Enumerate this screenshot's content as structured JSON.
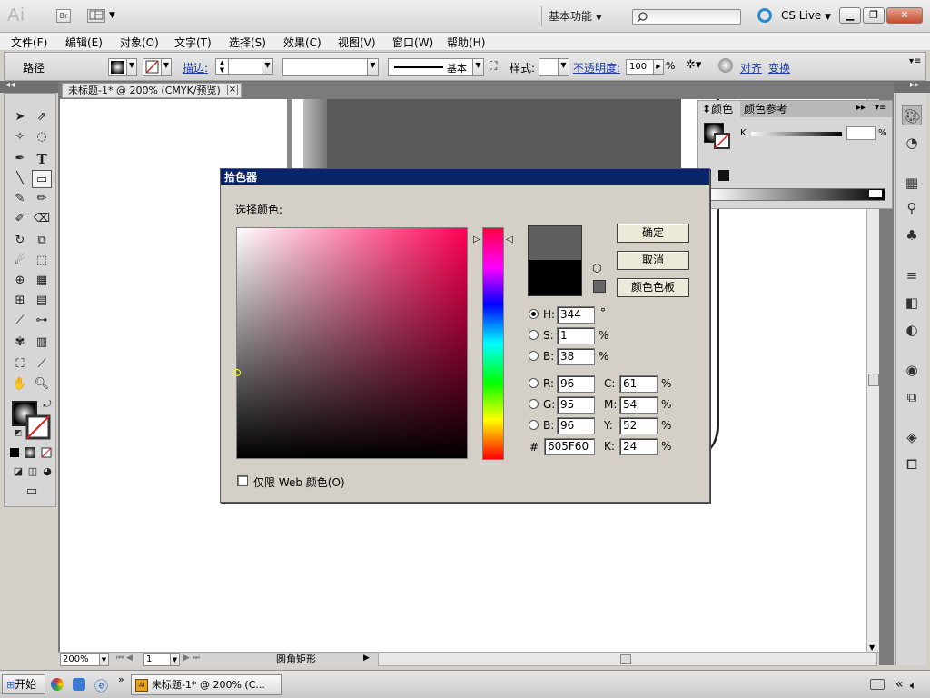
{
  "app": {
    "logo": "Ai",
    "bridge": "Br",
    "workspace": "基本功能",
    "cs_live": "CS Live"
  },
  "menu": [
    "文件(F)",
    "编辑(E)",
    "对象(O)",
    "文字(T)",
    "选择(S)",
    "效果(C)",
    "视图(V)",
    "窗口(W)",
    "帮助(H)"
  ],
  "control": {
    "object_type": "路径",
    "stroke_label": "描边:",
    "stroke_style": "基本",
    "style_label": "样式:",
    "opacity_label": "不透明度:",
    "opacity_value": "100",
    "opacity_unit": "%",
    "align": "对齐",
    "transform": "变换"
  },
  "document": {
    "tab": "未标题-1* @ 200% (CMYK/预览)",
    "close": "×",
    "zoom": "200%",
    "page": "1",
    "status_tool": "圆角矩形"
  },
  "color_panel": {
    "tab_color": "颜色",
    "tab_guide": "颜色参考",
    "k_label": "K",
    "k_unit": "%"
  },
  "picker": {
    "title": "拾色器",
    "select_label": "选择颜色:",
    "ok": "确定",
    "cancel": "取消",
    "swatches": "颜色色板",
    "hsb": [
      {
        "label": "H:",
        "value": "344",
        "unit": "°"
      },
      {
        "label": "S:",
        "value": "1",
        "unit": "%"
      },
      {
        "label": "B:",
        "value": "38",
        "unit": "%"
      }
    ],
    "rgb": [
      {
        "label": "R:",
        "value": "96"
      },
      {
        "label": "G:",
        "value": "95"
      },
      {
        "label": "B:",
        "value": "96"
      }
    ],
    "cmyk": [
      {
        "label": "C:",
        "value": "61",
        "unit": "%"
      },
      {
        "label": "M:",
        "value": "54",
        "unit": "%"
      },
      {
        "label": "Y:",
        "value": "52",
        "unit": "%"
      },
      {
        "label": "K:",
        "value": "24",
        "unit": "%"
      }
    ],
    "hex_label": "#",
    "hex": "605F60",
    "web_only": "仅限 Web 颜色(O)",
    "hue_color": "#ff0055",
    "new_color": "#605F60",
    "current_color": "#000000"
  },
  "taskbar": {
    "start": "开始",
    "task": "未标题-1* @ 200% (C...",
    "chevron": "«"
  }
}
